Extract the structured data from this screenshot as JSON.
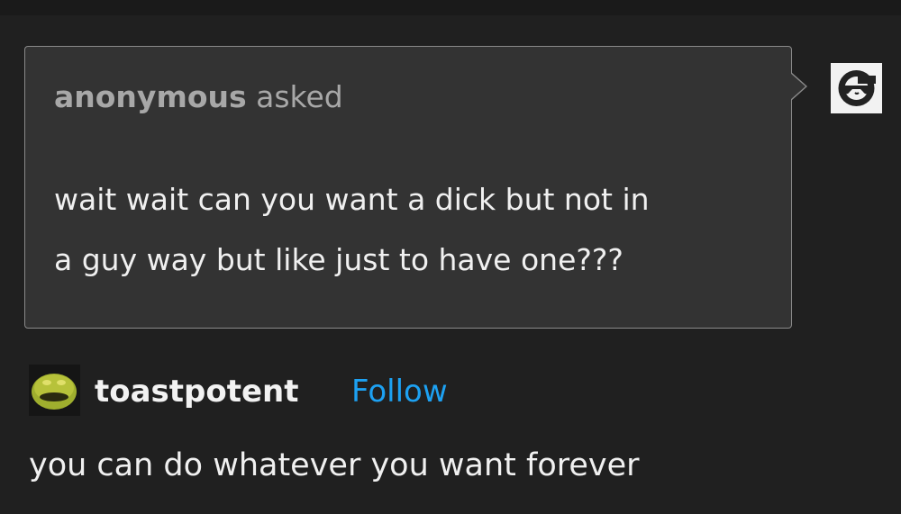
{
  "ask": {
    "asker_name": "anonymous",
    "asked_label": " asked",
    "question_line1": "wait wait can you want a dick but not in",
    "question_line2": "a guy way but like just to have one???",
    "avatar_icon": "anonymous-sunglasses-icon"
  },
  "answer": {
    "username": "toastpotent",
    "follow_label": "Follow",
    "avatar_icon": "kermit-avatar",
    "text": "you can do whatever you want forever"
  },
  "colors": {
    "background": "#202020",
    "ask_box": "#333333",
    "ask_border": "#8a8a8a",
    "asker_text": "#a8a8a8",
    "body_text": "#f0f0f0",
    "follow": "#1da1f2"
  }
}
